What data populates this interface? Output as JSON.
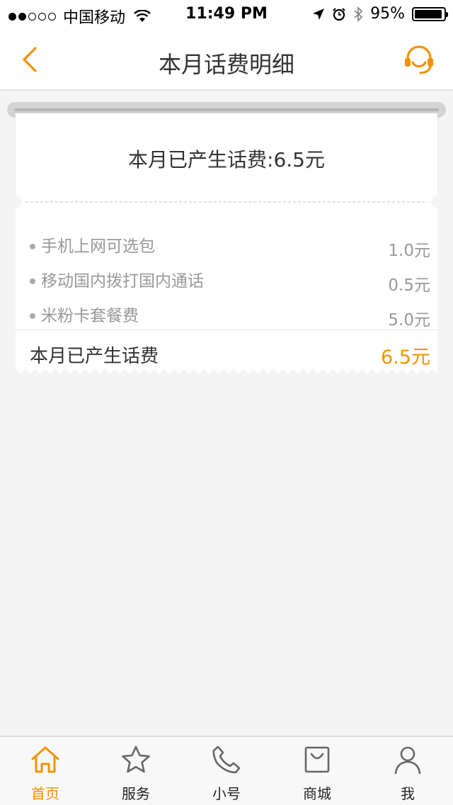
{
  "status_bar": {
    "carrier": "中国移动",
    "time": "11:49 PM",
    "battery": "95%",
    "battery_level": 0.95
  },
  "nav": {
    "title": "本月话费明细",
    "back_icon": "chevron-left-icon",
    "service_icon": "headset-icon"
  },
  "receipt": {
    "total_line": "本月已产生话费:6.5元",
    "items": [
      {
        "label": "手机上网可选包",
        "amount": "1.0元"
      },
      {
        "label": "移动国内拨打国内通话",
        "amount": "0.5元"
      },
      {
        "label": "米粉卡套餐费",
        "amount": "5.0元"
      }
    ],
    "summary_label": "本月已产生话费",
    "summary_amount": "6.5元"
  },
  "tabs": [
    {
      "label": "首页",
      "icon": "home-icon",
      "active": true
    },
    {
      "label": "服务",
      "icon": "star-icon",
      "active": false
    },
    {
      "label": "小号",
      "icon": "phone-icon",
      "active": false
    },
    {
      "label": "商城",
      "icon": "shopping-bag-icon",
      "active": false
    },
    {
      "label": "我",
      "icon": "user-icon",
      "active": false
    }
  ],
  "colors": {
    "accent": "#f39200",
    "background": "#f4f4f4",
    "muted_text": "#999999"
  }
}
